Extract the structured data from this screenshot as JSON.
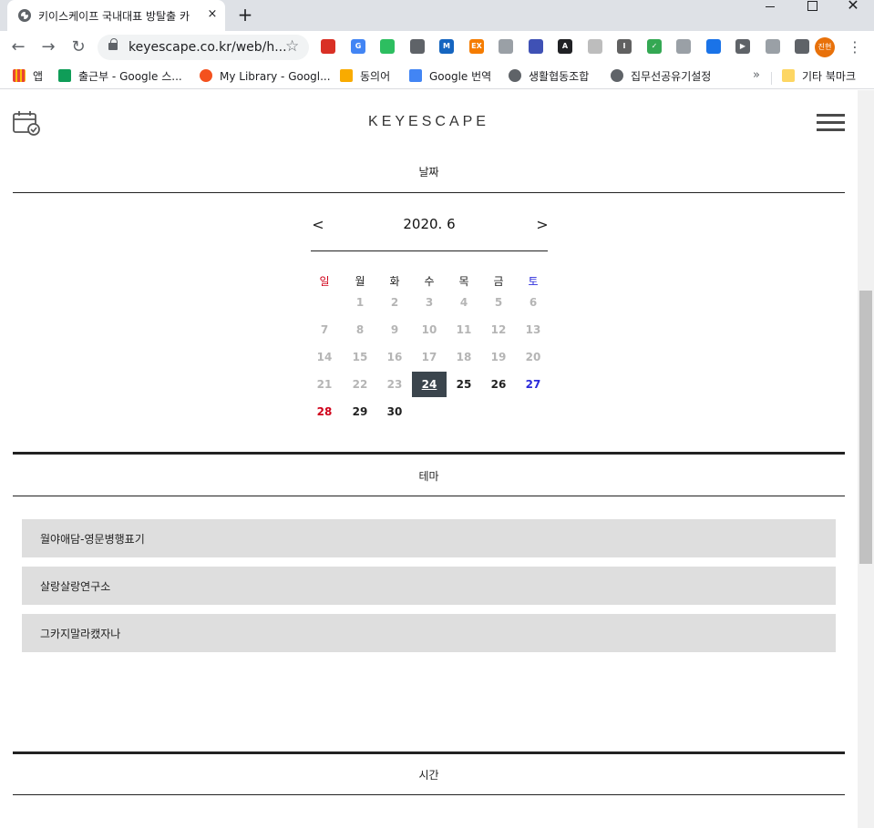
{
  "browser": {
    "tab_title": "키이스케이프 국내대표 방탈출 카",
    "tab_close": "×",
    "new_tab": "+",
    "url": "keyescape.co.kr/web/h...",
    "profile_label": "진현",
    "extensions": [
      {
        "name": "bookmark-red-icon",
        "color": "#d93025",
        "text": ""
      },
      {
        "name": "translate-icon",
        "color": "#4285f4",
        "text": "G"
      },
      {
        "name": "evernote-icon",
        "color": "#2dbe60",
        "text": ""
      },
      {
        "name": "pocket-icon",
        "color": "#5f6368",
        "text": ""
      },
      {
        "name": "mailtrack-icon",
        "color": "#1565c0",
        "text": "M"
      },
      {
        "name": "ex-icon",
        "color": "#f57c00",
        "text": "EX"
      },
      {
        "name": "screen-icon",
        "color": "#9aa0a6",
        "text": ""
      },
      {
        "name": "camera-icon",
        "color": "#3f51b5",
        "text": ""
      },
      {
        "name": "font-icon",
        "color": "#202124",
        "text": "A"
      },
      {
        "name": "cursor-icon",
        "color": "#bdbdbd",
        "text": ""
      },
      {
        "name": "info-icon",
        "color": "#616161",
        "text": "I"
      },
      {
        "name": "shield-green-icon",
        "color": "#34a853",
        "text": "✓"
      },
      {
        "name": "shield-gray-icon",
        "color": "#9aa0a6",
        "text": ""
      },
      {
        "name": "graduation-icon",
        "color": "#1a73e8",
        "text": ""
      },
      {
        "name": "play-icon",
        "color": "#5f6368",
        "text": "▶"
      },
      {
        "name": "cast-icon",
        "color": "#9aa0a6",
        "text": ""
      },
      {
        "name": "puzzle-icon",
        "color": "#5f6368",
        "text": ""
      }
    ]
  },
  "bookmarks": {
    "items": [
      {
        "name": "bookmark-apps",
        "label": "앱",
        "icon_color": "#ea4335"
      },
      {
        "name": "bookmark-attendance",
        "label": "출근부 - Google 스...",
        "icon_color": "#0f9d58"
      },
      {
        "name": "bookmark-my-library",
        "label": "My Library - Googl...",
        "icon_color": "#f4511e"
      },
      {
        "name": "bookmark-synonyms",
        "label": "동의어",
        "icon_color": "#f9ab00"
      },
      {
        "name": "bookmark-google-translate",
        "label": "Google 번역",
        "icon_color": "#4285f4"
      },
      {
        "name": "bookmark-coop",
        "label": "생활협동조합",
        "icon_color": "#5f6368"
      },
      {
        "name": "bookmark-shared-device",
        "label": "집무선공유기설정",
        "icon_color": "#5f6368"
      }
    ],
    "overflow": "»",
    "other": "기타 북마크"
  },
  "site": {
    "logo": "KEYESCAPE"
  },
  "date_section": {
    "title": "날짜",
    "month_label": "2020. 6",
    "prev": "<",
    "next": ">",
    "weekdays": [
      "일",
      "월",
      "화",
      "수",
      "목",
      "금",
      "토"
    ],
    "days": [
      {
        "d": "1",
        "col": 1,
        "row": 0,
        "state": "past"
      },
      {
        "d": "2",
        "col": 2,
        "row": 0,
        "state": "past"
      },
      {
        "d": "3",
        "col": 3,
        "row": 0,
        "state": "past"
      },
      {
        "d": "4",
        "col": 4,
        "row": 0,
        "state": "past"
      },
      {
        "d": "5",
        "col": 5,
        "row": 0,
        "state": "past"
      },
      {
        "d": "6",
        "col": 6,
        "row": 0,
        "state": "past"
      },
      {
        "d": "7",
        "col": 0,
        "row": 1,
        "state": "past"
      },
      {
        "d": "8",
        "col": 1,
        "row": 1,
        "state": "past"
      },
      {
        "d": "9",
        "col": 2,
        "row": 1,
        "state": "past"
      },
      {
        "d": "10",
        "col": 3,
        "row": 1,
        "state": "past"
      },
      {
        "d": "11",
        "col": 4,
        "row": 1,
        "state": "past"
      },
      {
        "d": "12",
        "col": 5,
        "row": 1,
        "state": "past"
      },
      {
        "d": "13",
        "col": 6,
        "row": 1,
        "state": "past"
      },
      {
        "d": "14",
        "col": 0,
        "row": 2,
        "state": "past"
      },
      {
        "d": "15",
        "col": 1,
        "row": 2,
        "state": "past"
      },
      {
        "d": "16",
        "col": 2,
        "row": 2,
        "state": "past"
      },
      {
        "d": "17",
        "col": 3,
        "row": 2,
        "state": "past"
      },
      {
        "d": "18",
        "col": 4,
        "row": 2,
        "state": "past"
      },
      {
        "d": "19",
        "col": 5,
        "row": 2,
        "state": "past"
      },
      {
        "d": "20",
        "col": 6,
        "row": 2,
        "state": "past"
      },
      {
        "d": "21",
        "col": 0,
        "row": 3,
        "state": "past"
      },
      {
        "d": "22",
        "col": 1,
        "row": 3,
        "state": "past"
      },
      {
        "d": "23",
        "col": 2,
        "row": 3,
        "state": "past"
      },
      {
        "d": "24",
        "col": 3,
        "row": 3,
        "state": "selected"
      },
      {
        "d": "25",
        "col": 4,
        "row": 3,
        "state": "normal"
      },
      {
        "d": "26",
        "col": 5,
        "row": 3,
        "state": "normal"
      },
      {
        "d": "27",
        "col": 6,
        "row": 3,
        "state": "sat"
      },
      {
        "d": "28",
        "col": 0,
        "row": 4,
        "state": "sun"
      },
      {
        "d": "29",
        "col": 1,
        "row": 4,
        "state": "normal"
      },
      {
        "d": "30",
        "col": 2,
        "row": 4,
        "state": "normal"
      }
    ],
    "colors": {
      "sunday": "#d0021b",
      "saturday": "#2b2bdb",
      "selected_bg": "#3b454d",
      "past": "#b5b5b5"
    }
  },
  "theme_section": {
    "title": "테마",
    "themes": [
      "월야애담-영문병행표기",
      "살랑살랑연구소",
      "그카지말라캤자나"
    ]
  },
  "time_section": {
    "title": "시간"
  }
}
